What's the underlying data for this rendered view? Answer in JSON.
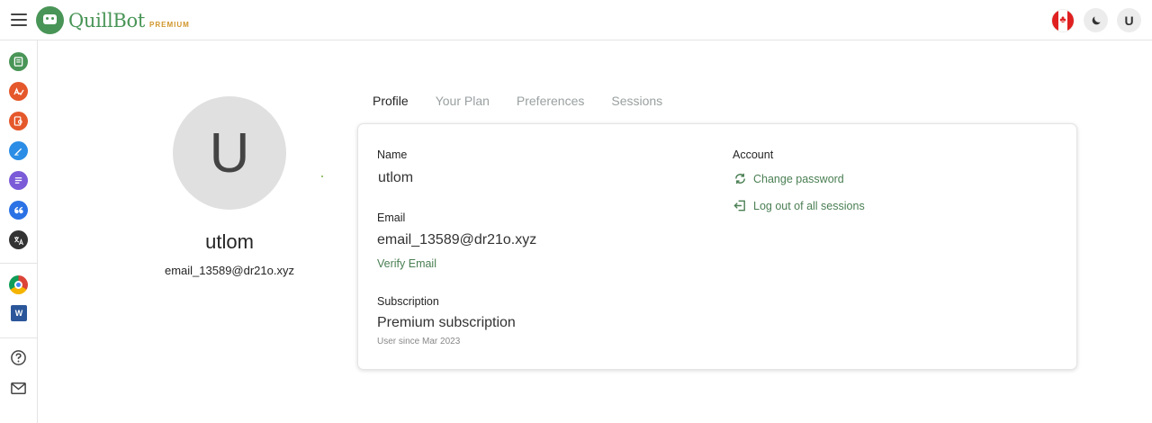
{
  "header": {
    "logo_text": "QuillBot",
    "logo_badge": "PREMIUM",
    "avatar_initial": "U"
  },
  "sidebar": {
    "icons": [
      {
        "name": "paraphraser-icon",
        "color": "#499557"
      },
      {
        "name": "grammar-checker-icon",
        "color": "#e5582b"
      },
      {
        "name": "plagiarism-checker-icon",
        "color": "#e5582b"
      },
      {
        "name": "co-writer-icon",
        "color": "#2b8de5"
      },
      {
        "name": "summarizer-icon",
        "color": "#7b5bd8"
      },
      {
        "name": "citation-generator-icon",
        "color": "#2b72e5"
      },
      {
        "name": "translator-icon",
        "color": "#333333"
      }
    ]
  },
  "profile": {
    "initial": "U",
    "name": "utlom",
    "email": "email_13589@dr21o.xyz"
  },
  "tabs": [
    {
      "label": "Profile",
      "active": true
    },
    {
      "label": "Your Plan",
      "active": false
    },
    {
      "label": "Preferences",
      "active": false
    },
    {
      "label": "Sessions",
      "active": false
    }
  ],
  "card": {
    "name_label": "Name",
    "name_value": "utlom",
    "email_label": "Email",
    "email_value": "email_13589@dr21o.xyz",
    "verify_link": "Verify Email",
    "subscription_label": "Subscription",
    "subscription_value": "Premium subscription",
    "user_since": "User since Mar 2023",
    "account_label": "Account",
    "change_password": "Change password",
    "logout_all": "Log out of all sessions"
  },
  "colors": {
    "brand_green": "#499557",
    "link_green": "#4a7f53",
    "premium_gold": "#d0952a"
  }
}
